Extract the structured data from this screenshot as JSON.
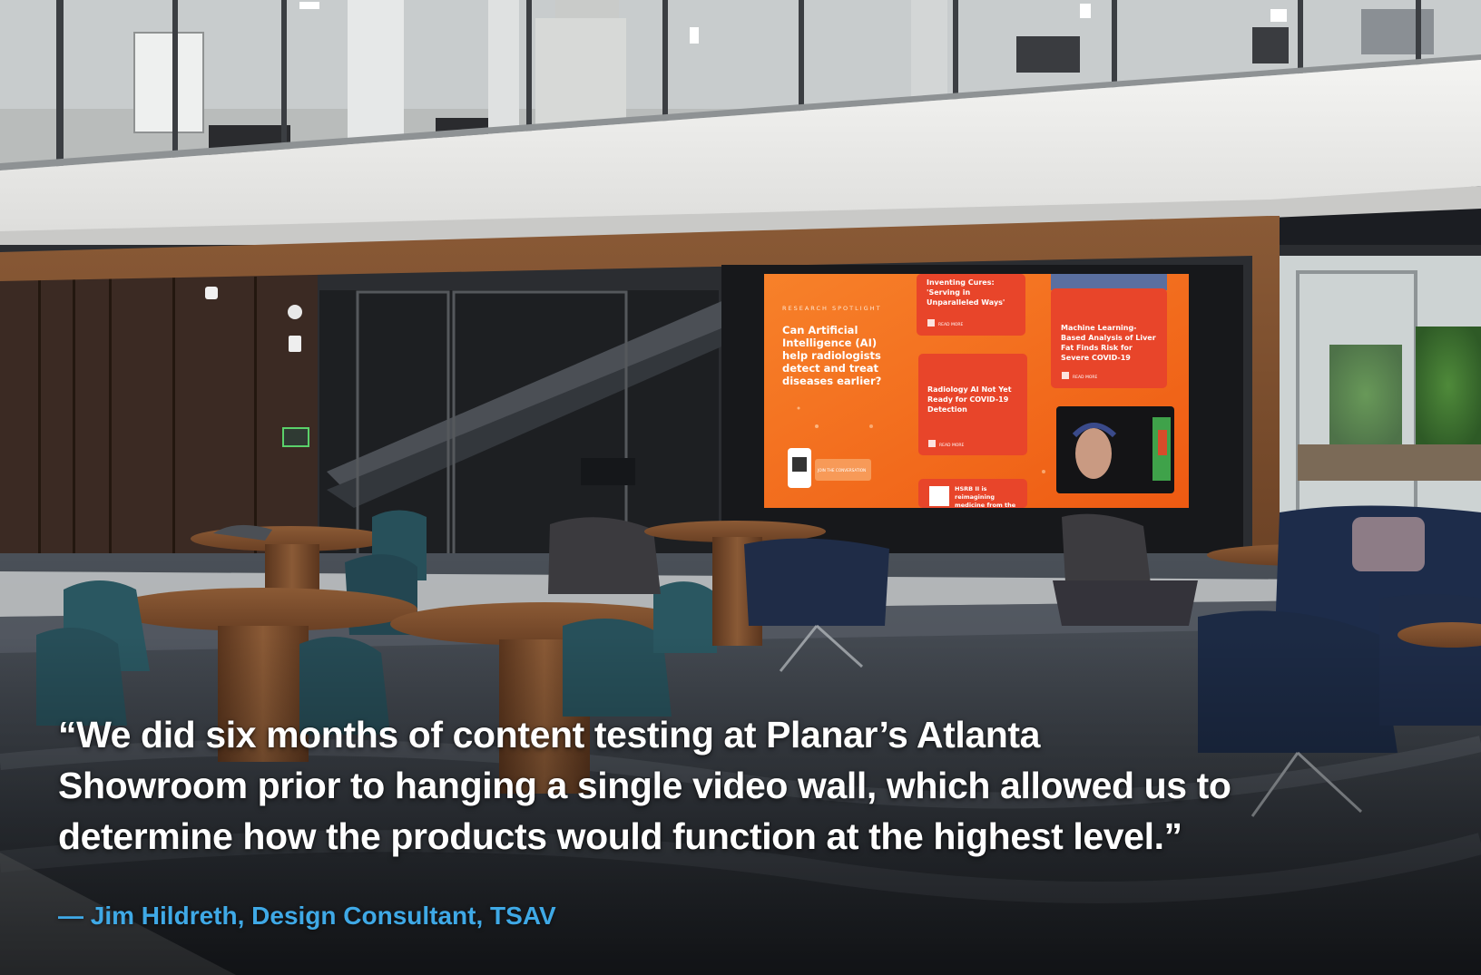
{
  "quote": {
    "lines": [
      "“We did six months of content testing at Planar’s Atlanta",
      "Showroom prior to hanging a single video wall, which allowed us to",
      "determine how the products would function at the highest level.”"
    ],
    "attribution": "— Jim Hildreth, Design Consultant, TSAV"
  },
  "video_wall": {
    "eyebrow": "RESEARCH SPOTLIGHT",
    "headline_lines": [
      "Can Artificial",
      "Intelligence (AI)",
      "help radiologists",
      "detect and treat",
      "diseases earlier?"
    ],
    "qr_cta": "JOIN THE CONVERSATION",
    "cards": [
      {
        "lines": [
          "Inventing Cures:",
          "'Serving in",
          "Unparalleled Ways'"
        ],
        "link": "READ MORE"
      },
      {
        "lines": [
          "Machine Learning-",
          "Based Analysis of Liver",
          "Fat Finds Risk for",
          "Severe COVID-19"
        ],
        "link": "READ MORE"
      },
      {
        "lines": [
          "Radiology AI Not Yet",
          "Ready for COVID-19",
          "Detection"
        ],
        "link": "READ MORE"
      },
      {
        "lines": [
          "HSRB II is",
          "reimagining",
          "medicine from the"
        ]
      }
    ]
  },
  "colors": {
    "quote_text": "#ffffff",
    "attribution": "#3fa9e6",
    "screen_orange": "#f26a1b",
    "card_red": "#e8452a"
  }
}
